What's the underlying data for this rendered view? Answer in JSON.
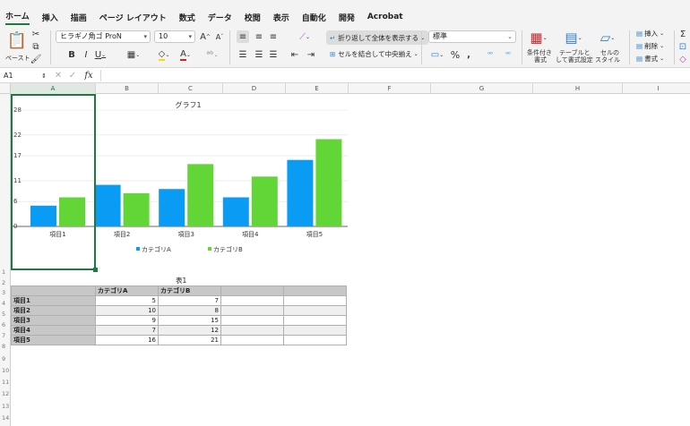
{
  "menu": {
    "tabs": [
      "ホーム",
      "挿入",
      "描画",
      "ページ レイアウト",
      "数式",
      "データ",
      "校閲",
      "表示",
      "自動化",
      "開発",
      "Acrobat"
    ],
    "active_tab": "ホーム"
  },
  "ribbon": {
    "paste_label": "ペースト",
    "font_name": "ヒラギノ角ゴ ProN",
    "font_size": "10",
    "wrap_text_label": "折り返して全体を表示する",
    "merge_center_label": "セルを結合して中央揃え",
    "number_format": "標準",
    "cond_format_label1": "条件付き",
    "cond_format_label2": "書式",
    "table_format_label1": "テーブルと",
    "table_format_label2": "して書式設定",
    "cell_style_label1": "セルの",
    "cell_style_label2": "スタイル",
    "insert_label": "挿入",
    "delete_label": "削除",
    "format_label": "書式",
    "colors": {
      "accent": "#1d7a3e",
      "wrap_bg": "#dcdcdc"
    }
  },
  "formula_bar": {
    "name_box": "A1",
    "fx_symbol": "fx",
    "content": ""
  },
  "sheet": {
    "columns": [
      "A",
      "B",
      "C",
      "D",
      "E",
      "F",
      "G",
      "H",
      "I"
    ],
    "active_column": "A",
    "rows": [
      "1",
      "2",
      "3",
      "4",
      "5",
      "6",
      "7",
      "8",
      "9",
      "10",
      "11",
      "12",
      "13",
      "14"
    ]
  },
  "chart_data": {
    "type": "bar",
    "title": "グラフ1",
    "categories": [
      "項目1",
      "項目2",
      "項目3",
      "項目4",
      "項目5"
    ],
    "series": [
      {
        "name": "カテゴリA",
        "values": [
          5,
          10,
          9,
          7,
          16
        ],
        "color": "#0a9cf5"
      },
      {
        "name": "カテゴリB",
        "values": [
          7,
          8,
          15,
          12,
          21
        ],
        "color": "#63d637"
      }
    ],
    "ylim": [
      0,
      28
    ],
    "yticks": [
      "0",
      "6",
      "11",
      "17",
      "22",
      "28"
    ],
    "grid": true,
    "legend": "bottom"
  },
  "table": {
    "title": "表1",
    "headers": [
      "",
      "カテゴリA",
      "カテゴリB",
      "",
      ""
    ],
    "rows": [
      {
        "label": "項目1",
        "a": "5",
        "b": "7"
      },
      {
        "label": "項目2",
        "a": "10",
        "b": "8"
      },
      {
        "label": "項目3",
        "a": "9",
        "b": "15"
      },
      {
        "label": "項目4",
        "a": "7",
        "b": "12"
      },
      {
        "label": "項目5",
        "a": "16",
        "b": "21"
      }
    ]
  }
}
